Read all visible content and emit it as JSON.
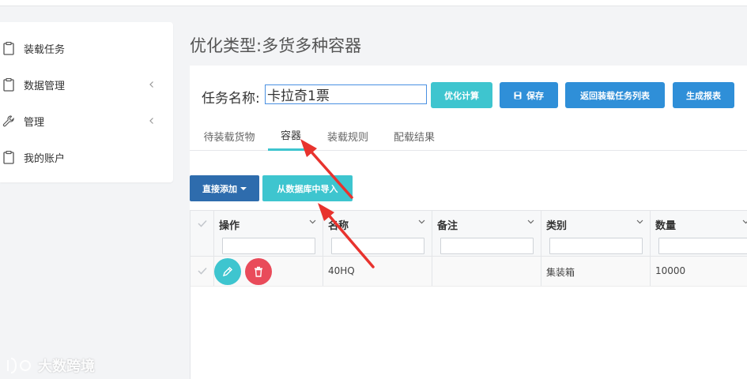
{
  "sidebar": {
    "items": [
      {
        "label": "装载任务",
        "icon": "clipboard-icon",
        "has_chevron": false
      },
      {
        "label": "数据管理",
        "icon": "clipboard-icon",
        "has_chevron": true
      },
      {
        "label": "管理",
        "icon": "wrench-icon",
        "has_chevron": true
      },
      {
        "label": "我的账户",
        "icon": "clipboard-icon",
        "has_chevron": false
      }
    ]
  },
  "page": {
    "title": "优化类型:多货多种容器"
  },
  "task": {
    "label": "任务名称:",
    "value": "卡拉奇1票"
  },
  "toolbar": {
    "optimize_label": "优化计算",
    "save_label": "保存",
    "return_label": "返回装载任务列表",
    "report_label": "生成报表"
  },
  "tabs": [
    {
      "label": "待装载货物",
      "active": false
    },
    {
      "label": "容器",
      "active": true
    },
    {
      "label": "装载规则",
      "active": false
    },
    {
      "label": "配载结果",
      "active": false
    }
  ],
  "actions": {
    "add_label": "直接添加",
    "import_label": "从数据库中导入"
  },
  "grid": {
    "columns": [
      "操作",
      "名称",
      "备注",
      "类别",
      "数量"
    ],
    "rows": [
      {
        "name": "40HQ",
        "note": "",
        "category": "集装箱",
        "quantity": "10000"
      }
    ]
  },
  "watermark": {
    "text": "大数跨境"
  },
  "colors": {
    "teal": "#3ec5cf",
    "blue": "#2f8fd8",
    "dark_blue": "#2e6cad",
    "delete_red": "#e94b5a",
    "arrow_red": "#e8332e"
  }
}
